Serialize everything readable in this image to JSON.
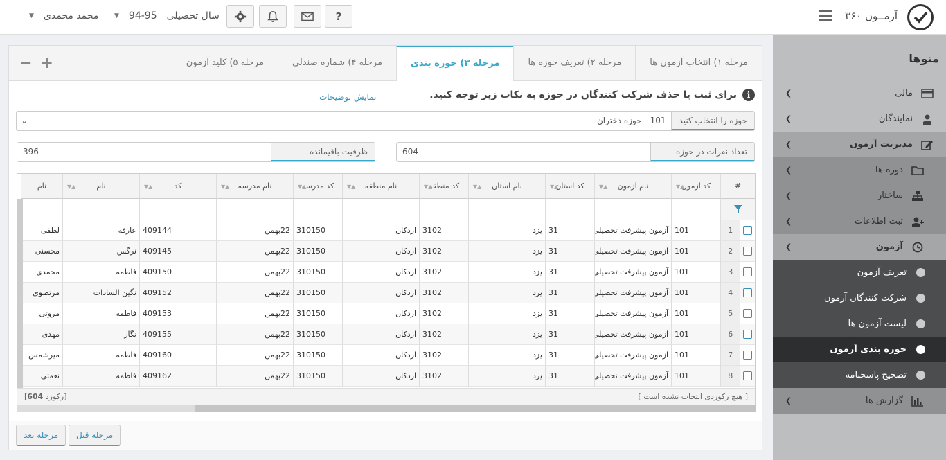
{
  "header": {
    "app_title": "آزمــون ۳۶۰",
    "academic_year_label": "سال تحصیلی",
    "academic_year_value": "94-95",
    "user_name": "محمد محمدی"
  },
  "sidebar": {
    "title": "منوها",
    "items": [
      {
        "label": "مالی",
        "icon": "card-icon"
      },
      {
        "label": "نمایندگان",
        "icon": "agent-icon"
      },
      {
        "label": "مدیریت آزمون",
        "icon": "edit-icon"
      },
      {
        "label": "دوره ها",
        "icon": "folder-icon"
      },
      {
        "label": "ساختار",
        "icon": "sitemap-icon"
      },
      {
        "label": "ثبت اطلاعات",
        "icon": "user-plus-icon"
      },
      {
        "label": "آزمون",
        "icon": "clock-icon"
      },
      {
        "label": "تعریف آزمون"
      },
      {
        "label": "شرکت کنندگان آزمون"
      },
      {
        "label": "لیست آزمون ها"
      },
      {
        "label": "حوزه بندی آزمون"
      },
      {
        "label": "تصحیح پاسخنامه"
      },
      {
        "label": "گزارش ها",
        "icon": "bar-chart-icon"
      }
    ]
  },
  "tabs": [
    {
      "label": "مرحله ۱) انتخاب آزمون ها"
    },
    {
      "label": "مرحله ۲) تعریف حوزه ها"
    },
    {
      "label": "مرحله ۳) حوزه بندی"
    },
    {
      "label": "مرحله ۴) شماره صندلی"
    },
    {
      "label": "مرحله ۵) کلید آزمون"
    }
  ],
  "notice": {
    "text": "برای ثبت یا حذف شرکت کنندگان در حوزه به نکات زیر توجه کنید.",
    "link": "نمایش توضیحات"
  },
  "zone_select": {
    "label": "حوزه را انتخاب کنید",
    "value": "101 - حوزه دختران"
  },
  "count_field": {
    "label": "تعداد نفرات در حوزه",
    "value": "604"
  },
  "capacity_field": {
    "label": "ظرفیت باقیمانده",
    "value": "396"
  },
  "grid": {
    "columns": [
      "#",
      "کد آزمون",
      "نام آزمون",
      "کد استان",
      "نام استان",
      "کد منطقه",
      "نام منطقه",
      "کد مدرسه",
      "نام مدرسه",
      "کد",
      "نام",
      "نام"
    ],
    "rows": [
      [
        "1",
        "101",
        "آزمون پیشرفت تحصیلی",
        "31",
        "یزد",
        "3102",
        "اردکان",
        "310150",
        "22بهمن",
        "409144",
        "عارفه",
        "لطفی"
      ],
      [
        "2",
        "101",
        "آزمون پیشرفت تحصیلی",
        "31",
        "یزد",
        "3102",
        "اردکان",
        "310150",
        "22بهمن",
        "409145",
        "نرگس",
        "محسنی"
      ],
      [
        "3",
        "101",
        "آزمون پیشرفت تحصیلی",
        "31",
        "یزد",
        "3102",
        "اردکان",
        "310150",
        "22بهمن",
        "409150",
        "فاطمه",
        "محمدی"
      ],
      [
        "4",
        "101",
        "آزمون پیشرفت تحصیلی",
        "31",
        "یزد",
        "3102",
        "اردکان",
        "310150",
        "22بهمن",
        "409152",
        "نگین السادات",
        "مرتضوی"
      ],
      [
        "5",
        "101",
        "آزمون پیشرفت تحصیلی",
        "31",
        "یزد",
        "3102",
        "اردکان",
        "310150",
        "22بهمن",
        "409153",
        "فاطمه",
        "مروتی"
      ],
      [
        "6",
        "101",
        "آزمون پیشرفت تحصیلی",
        "31",
        "یزد",
        "3102",
        "اردکان",
        "310150",
        "22بهمن",
        "409155",
        "نگار",
        "مهدی"
      ],
      [
        "7",
        "101",
        "آزمون پیشرفت تحصیلی",
        "31",
        "یزد",
        "3102",
        "اردکان",
        "310150",
        "22بهمن",
        "409160",
        "فاطمه",
        "میرشمس"
      ],
      [
        "8",
        "101",
        "آزمون پیشرفت تحصیلی",
        "31",
        "یزد",
        "3102",
        "اردکان",
        "310150",
        "22بهمن",
        "409162",
        "فاطمه",
        "نعمتی"
      ]
    ],
    "selection_text": "[ هیچ رکوردی انتخاب نشده است ]",
    "record_count_prefix": "[",
    "record_count": "604",
    "record_count_suffix": "رکورد]"
  },
  "buttons": {
    "prev": "مرحله قبل",
    "next": "مرحله بعد"
  },
  "colors": {
    "accent": "#3aa9c9",
    "sidebar_bg": "#bcbec0",
    "sidebar_dark": "#4c4d4f"
  }
}
